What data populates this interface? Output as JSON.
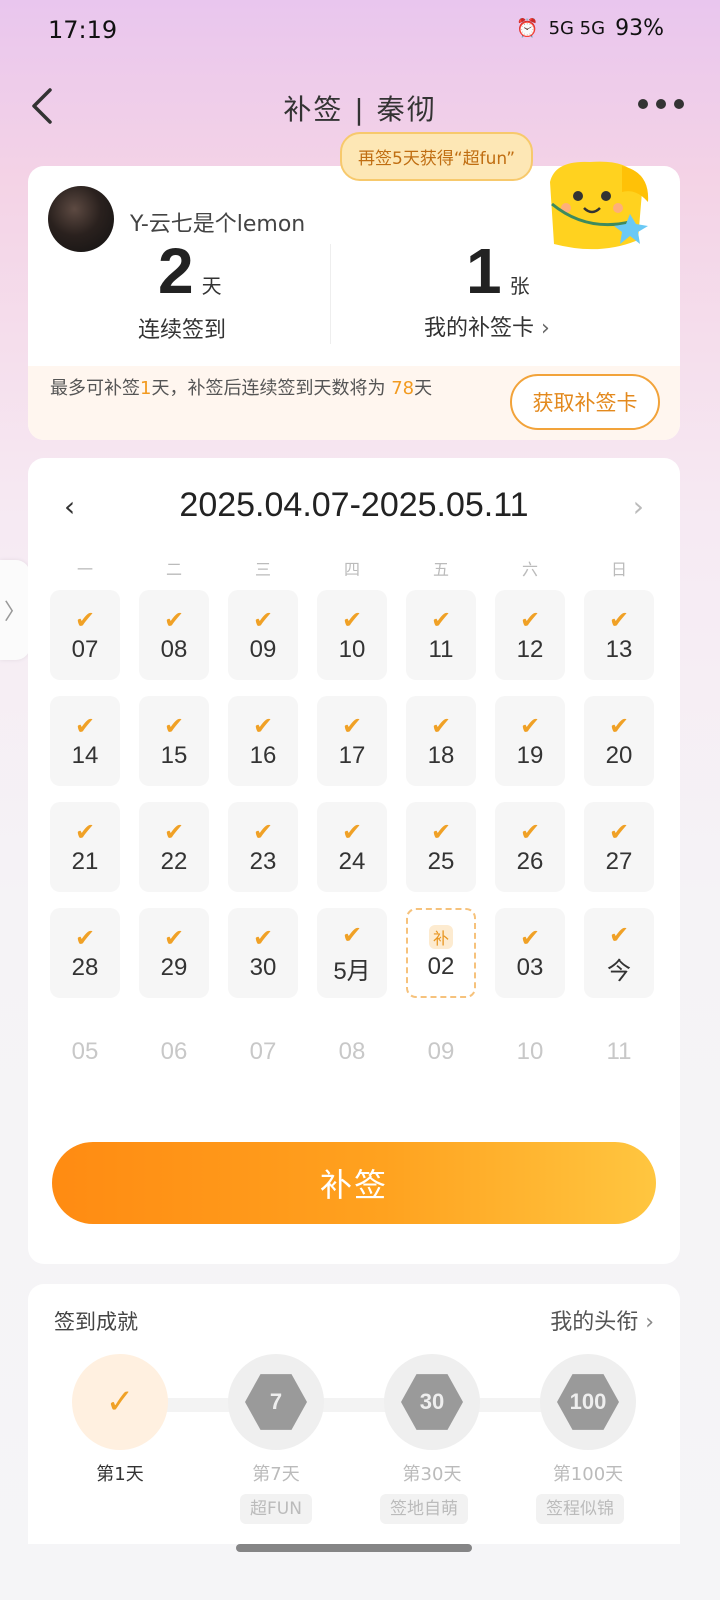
{
  "status_bar": {
    "time": "17:19",
    "network": "5G 5G",
    "battery": "93%"
  },
  "header": {
    "title": "补签 | 秦彻"
  },
  "promo": {
    "text": "再签5天获得“超fun”"
  },
  "profile": {
    "username": "Y-云七是个lemon",
    "streak_num": "2",
    "streak_unit": "天",
    "streak_label": "连续签到",
    "cards_num": "1",
    "cards_unit": "张",
    "cards_label": "我的补签卡",
    "notice_prefix": "最多可补签",
    "notice_max": "1",
    "notice_mid": "天，补签后连续签到天数将为",
    "notice_days": "78",
    "notice_suffix": "天",
    "get_card_button": "获取补签卡"
  },
  "calendar": {
    "range": "2025.04.07-2025.05.11",
    "weekdays": [
      "一",
      "二",
      "三",
      "四",
      "五",
      "六",
      "日"
    ],
    "weeks": [
      [
        "07",
        "08",
        "09",
        "10",
        "11",
        "12",
        "13"
      ],
      [
        "14",
        "15",
        "16",
        "17",
        "18",
        "19",
        "20"
      ],
      [
        "21",
        "22",
        "23",
        "24",
        "25",
        "26",
        "27"
      ],
      [
        "28",
        "29",
        "30",
        "5月",
        "02",
        "03",
        "今"
      ]
    ],
    "makeup_badge": "补",
    "future": [
      "05",
      "06",
      "07",
      "08",
      "09",
      "10",
      "11"
    ],
    "makeup_button": "补签"
  },
  "achievements": {
    "title": "签到成就",
    "link": "我的头衔",
    "items": [
      {
        "label": "第1天",
        "tag": "",
        "badge": "✓"
      },
      {
        "label": "第7天",
        "tag": "超FUN",
        "badge": "7"
      },
      {
        "label": "第30天",
        "tag": "签地自萌",
        "badge": "30"
      },
      {
        "label": "第100天",
        "tag": "签程似锦",
        "badge": "100"
      }
    ]
  },
  "colors": {
    "accent": "#f0a126",
    "button_start": "#ff8b12",
    "button_end": "#ffc640"
  }
}
